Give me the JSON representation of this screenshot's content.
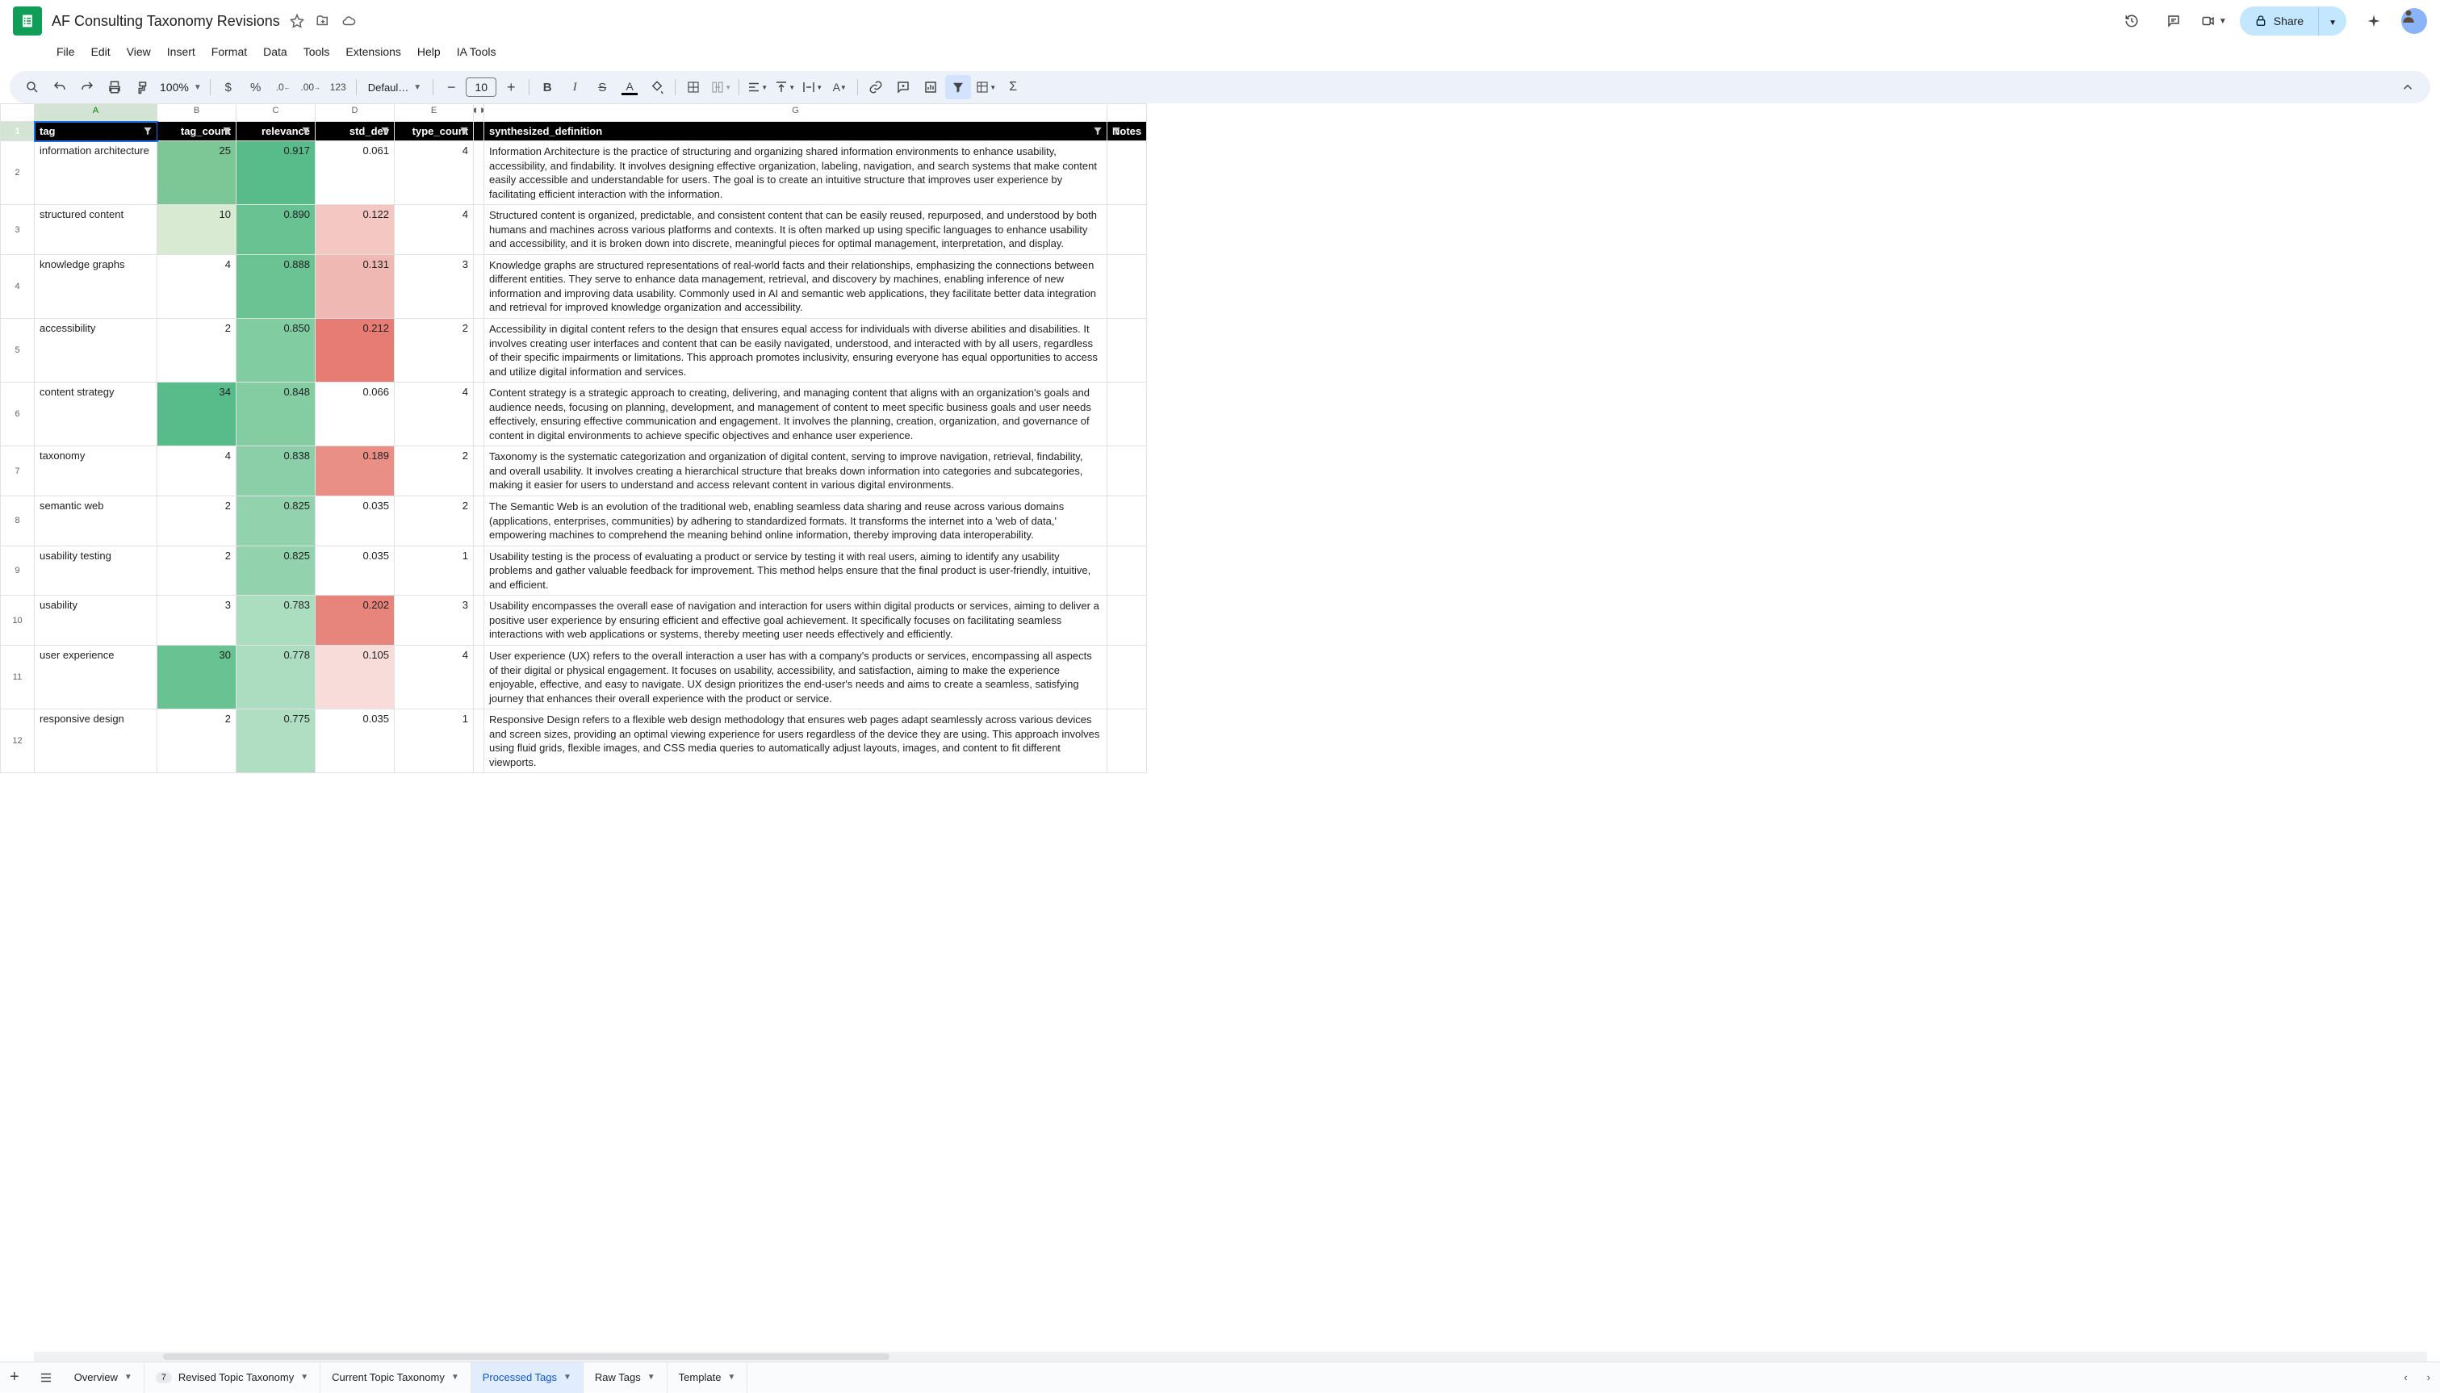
{
  "title": "AF Consulting Taxonomy Revisions",
  "menus": [
    "File",
    "Edit",
    "View",
    "Insert",
    "Format",
    "Data",
    "Tools",
    "Extensions",
    "Help",
    "IA Tools"
  ],
  "share_label": "Share",
  "zoom": "100%",
  "font_family": "Defaul…",
  "font_size": "10",
  "columns": {
    "labels": [
      "A",
      "B",
      "C",
      "D",
      "E",
      "G"
    ],
    "widths": [
      152,
      98,
      98,
      98,
      98,
      772,
      42
    ],
    "headers": [
      "tag",
      "tag_count",
      "relevance",
      "std_dev",
      "type_count",
      "synthesized_definition",
      "Notes"
    ]
  },
  "rows": [
    {
      "tag": "information architecture",
      "tag_count": 25,
      "relevance": "0.917",
      "std_dev": "0.061",
      "type_count": 4,
      "def": "Information Architecture is the practice of structuring and organizing shared information environments to enhance usability, accessibility, and findability. It involves designing effective organization, labeling, navigation, and search systems that make content easily accessible and understandable for users. The goal is to create an intuitive structure that improves user experience by facilitating efficient interaction with the information.",
      "b_bg": "#7cc795",
      "c_bg": "#57bb8a",
      "d_bg": "#ffffff"
    },
    {
      "tag": "structured content",
      "tag_count": 10,
      "relevance": "0.890",
      "std_dev": "0.122",
      "type_count": 4,
      "def": "Structured content is organized, predictable, and consistent content that can be easily reused, repurposed, and understood by both humans and machines across various platforms and contexts. It is often marked up using specific languages to enhance usability and accessibility, and it is broken down into discrete, meaningful pieces for optimal management, interpretation, and display.",
      "b_bg": "#d9ead3",
      "c_bg": "#68c291",
      "d_bg": "#f4c7c3"
    },
    {
      "tag": "knowledge graphs",
      "tag_count": 4,
      "relevance": "0.888",
      "std_dev": "0.131",
      "type_count": 3,
      "def": "Knowledge graphs are structured representations of real-world facts and their relationships, emphasizing the connections between different entities. They serve to enhance data management, retrieval, and discovery by machines, enabling inference of new information and improving data usability. Commonly used in AI and semantic web applications, they facilitate better data integration and retrieval for improved knowledge organization and accessibility.",
      "b_bg": "#ffffff",
      "c_bg": "#6bc393",
      "d_bg": "#f0b8b3"
    },
    {
      "tag": "accessibility",
      "tag_count": 2,
      "relevance": "0.850",
      "std_dev": "0.212",
      "type_count": 2,
      "def": "Accessibility in digital content refers to the design that ensures equal access for individuals with diverse abilities and disabilities. It involves creating user interfaces and content that can be easily navigated, understood, and interacted with by all users, regardless of their specific impairments or limitations. This approach promotes inclusivity, ensuring everyone has equal opportunities to access and utilize digital information and services.",
      "b_bg": "#ffffff",
      "c_bg": "#82cca1",
      "d_bg": "#e67c73"
    },
    {
      "tag": "content strategy",
      "tag_count": 34,
      "relevance": "0.848",
      "std_dev": "0.066",
      "type_count": 4,
      "def": "Content strategy is a strategic approach to creating, delivering, and managing content that aligns with an organization's goals and audience needs, focusing on planning, development, and management of content to meet specific business goals and user needs effectively, ensuring effective communication and engagement. It involves the planning, creation, organization, and governance of content in digital environments to achieve specific objectives and enhance user experience.",
      "b_bg": "#57bb8a",
      "c_bg": "#84cca2",
      "d_bg": "#ffffff"
    },
    {
      "tag": "taxonomy",
      "tag_count": 4,
      "relevance": "0.838",
      "std_dev": "0.189",
      "type_count": 2,
      "def": "Taxonomy is the systematic categorization and organization of digital content, serving to improve navigation, retrieval, findability, and overall usability. It involves creating a hierarchical structure that breaks down information into categories and subcategories, making it easier for users to understand and access relevant content in various digital environments.",
      "b_bg": "#ffffff",
      "c_bg": "#8acfa7",
      "d_bg": "#e98f86"
    },
    {
      "tag": "semantic web",
      "tag_count": 2,
      "relevance": "0.825",
      "std_dev": "0.035",
      "type_count": 2,
      "def": "The Semantic Web is an evolution of the traditional web, enabling seamless data sharing and reuse across various domains (applications, enterprises, communities) by adhering to standardized formats. It transforms the internet into a 'web of data,' empowering machines to comprehend the meaning behind online information, thereby improving data interoperability.",
      "b_bg": "#ffffff",
      "c_bg": "#92d2ad",
      "d_bg": "#ffffff"
    },
    {
      "tag": "usability testing",
      "tag_count": 2,
      "relevance": "0.825",
      "std_dev": "0.035",
      "type_count": 1,
      "def": "Usability testing is the process of evaluating a product or service by testing it with real users, aiming to identify any usability problems and gather valuable feedback for improvement. This method helps ensure that the final product is user-friendly, intuitive, and efficient.",
      "b_bg": "#ffffff",
      "c_bg": "#92d2ad",
      "d_bg": "#ffffff"
    },
    {
      "tag": "usability",
      "tag_count": 3,
      "relevance": "0.783",
      "std_dev": "0.202",
      "type_count": 3,
      "def": "Usability encompasses the overall ease of navigation and interaction for users within digital products or services, aiming to deliver a positive user experience by ensuring efficient and effective goal achievement. It specifically focuses on facilitating seamless interactions with web applications or systems, thereby meeting user needs effectively and efficiently.",
      "b_bg": "#ffffff",
      "c_bg": "#abddbf",
      "d_bg": "#e7857c"
    },
    {
      "tag": "user experience",
      "tag_count": 30,
      "relevance": "0.778",
      "std_dev": "0.105",
      "type_count": 4,
      "def": "User experience (UX) refers to the overall interaction a user has with a company's products or services, encompassing all aspects of their digital or physical engagement. It focuses on usability, accessibility, and satisfaction, aiming to make the experience enjoyable, effective, and easy to navigate. UX design prioritizes the end-user's needs and aims to create a seamless, satisfying journey that enhances their overall experience with the product or service.",
      "b_bg": "#68c291",
      "c_bg": "#adddc1",
      "d_bg": "#f8dcd9"
    },
    {
      "tag": "responsive design",
      "tag_count": 2,
      "relevance": "0.775",
      "std_dev": "0.035",
      "type_count": 1,
      "def": "Responsive Design refers to a flexible web design methodology that ensures web pages adapt seamlessly across various devices and screen sizes, providing an optimal viewing experience for users regardless of the device they are using. This approach involves using fluid grids, flexible images, and CSS media queries to automatically adjust layouts, images, and content to fit different viewports.",
      "b_bg": "#ffffff",
      "c_bg": "#afdec2",
      "d_bg": "#ffffff"
    }
  ],
  "tabs": [
    {
      "label": "Overview",
      "active": false
    },
    {
      "label": "Revised Topic Taxonomy",
      "active": false,
      "badge": "7"
    },
    {
      "label": "Current Topic Taxonomy",
      "active": false
    },
    {
      "label": "Processed Tags",
      "active": true
    },
    {
      "label": "Raw Tags",
      "active": false
    },
    {
      "label": "Template",
      "active": false
    }
  ]
}
